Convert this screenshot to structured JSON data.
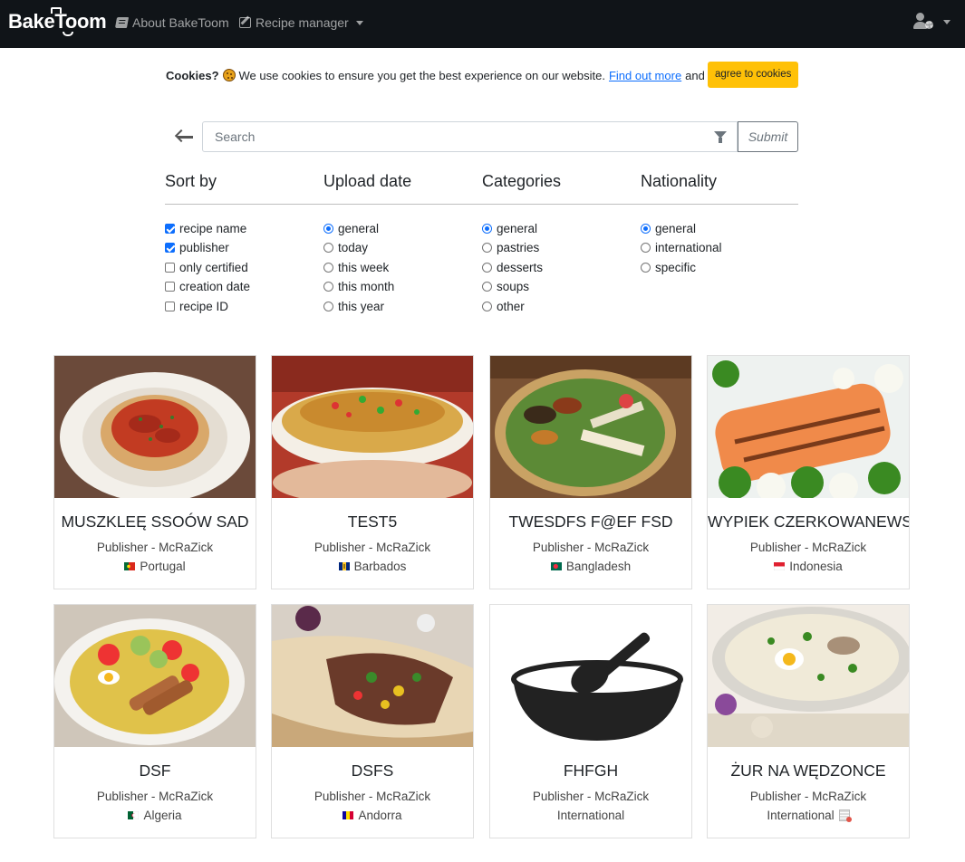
{
  "navbar": {
    "brand": "BakeToom",
    "about_label": "About BakeToom",
    "recipe_manager_label": "Recipe manager"
  },
  "cookie": {
    "lead": "Cookies?",
    "message": "We use cookies to ensure you get the best experience on our website.",
    "link_label": "Find out more",
    "and": "and",
    "agree_label": "agree to cookies"
  },
  "search": {
    "placeholder": "Search",
    "submit_label": "Submit"
  },
  "filters": {
    "sort_by": {
      "title": "Sort by",
      "options": [
        {
          "label": "recipe name",
          "checked": true
        },
        {
          "label": "publisher",
          "checked": true
        },
        {
          "label": "only certified",
          "checked": false
        },
        {
          "label": "creation date",
          "checked": false
        },
        {
          "label": "recipe ID",
          "checked": false
        }
      ]
    },
    "upload_date": {
      "title": "Upload date",
      "options": [
        {
          "label": "general",
          "checked": true
        },
        {
          "label": "today",
          "checked": false
        },
        {
          "label": "this week",
          "checked": false
        },
        {
          "label": "this month",
          "checked": false
        },
        {
          "label": "this year",
          "checked": false
        }
      ]
    },
    "categories": {
      "title": "Categories",
      "options": [
        {
          "label": "general",
          "checked": true
        },
        {
          "label": "pastries",
          "checked": false
        },
        {
          "label": "desserts",
          "checked": false
        },
        {
          "label": "soups",
          "checked": false
        },
        {
          "label": "other",
          "checked": false
        }
      ]
    },
    "nationality": {
      "title": "Nationality",
      "options": [
        {
          "label": "general",
          "checked": true
        },
        {
          "label": "international",
          "checked": false
        },
        {
          "label": "specific",
          "checked": false
        }
      ]
    }
  },
  "recipes": [
    {
      "title": "MUSZKLEĘ SSOÓW SAD",
      "publisher": "Publisher - McRaZick",
      "nationality": "Portugal",
      "image": "spaghetti-photo"
    },
    {
      "title": "TEST5",
      "publisher": "Publisher - McRaZick",
      "nationality": "Barbados",
      "image": "rice-dish-photo"
    },
    {
      "title": "TWESDFS F@EF FSD",
      "publisher": "Publisher - McRaZick",
      "nationality": "Bangladesh",
      "image": "platter-photo"
    },
    {
      "title": "WYPIEK CZERKOWANEWSKI",
      "publisher": "Publisher - McRaZick",
      "nationality": "Indonesia",
      "image": "salmon-photo"
    },
    {
      "title": "DSF",
      "publisher": "Publisher - McRaZick",
      "nationality": "Algeria",
      "image": "salad-photo"
    },
    {
      "title": "DSFS",
      "publisher": "Publisher - McRaZick",
      "nationality": "Andorra",
      "image": "wrap-photo"
    },
    {
      "title": "FHFGH",
      "publisher": "Publisher - McRaZick",
      "nationality": "International",
      "image": "bowl-spoon-icon"
    },
    {
      "title": "ŻUR NA WĘDZONCE",
      "publisher": "Publisher - McRaZick",
      "nationality": "International",
      "image": "soup-photo"
    }
  ]
}
